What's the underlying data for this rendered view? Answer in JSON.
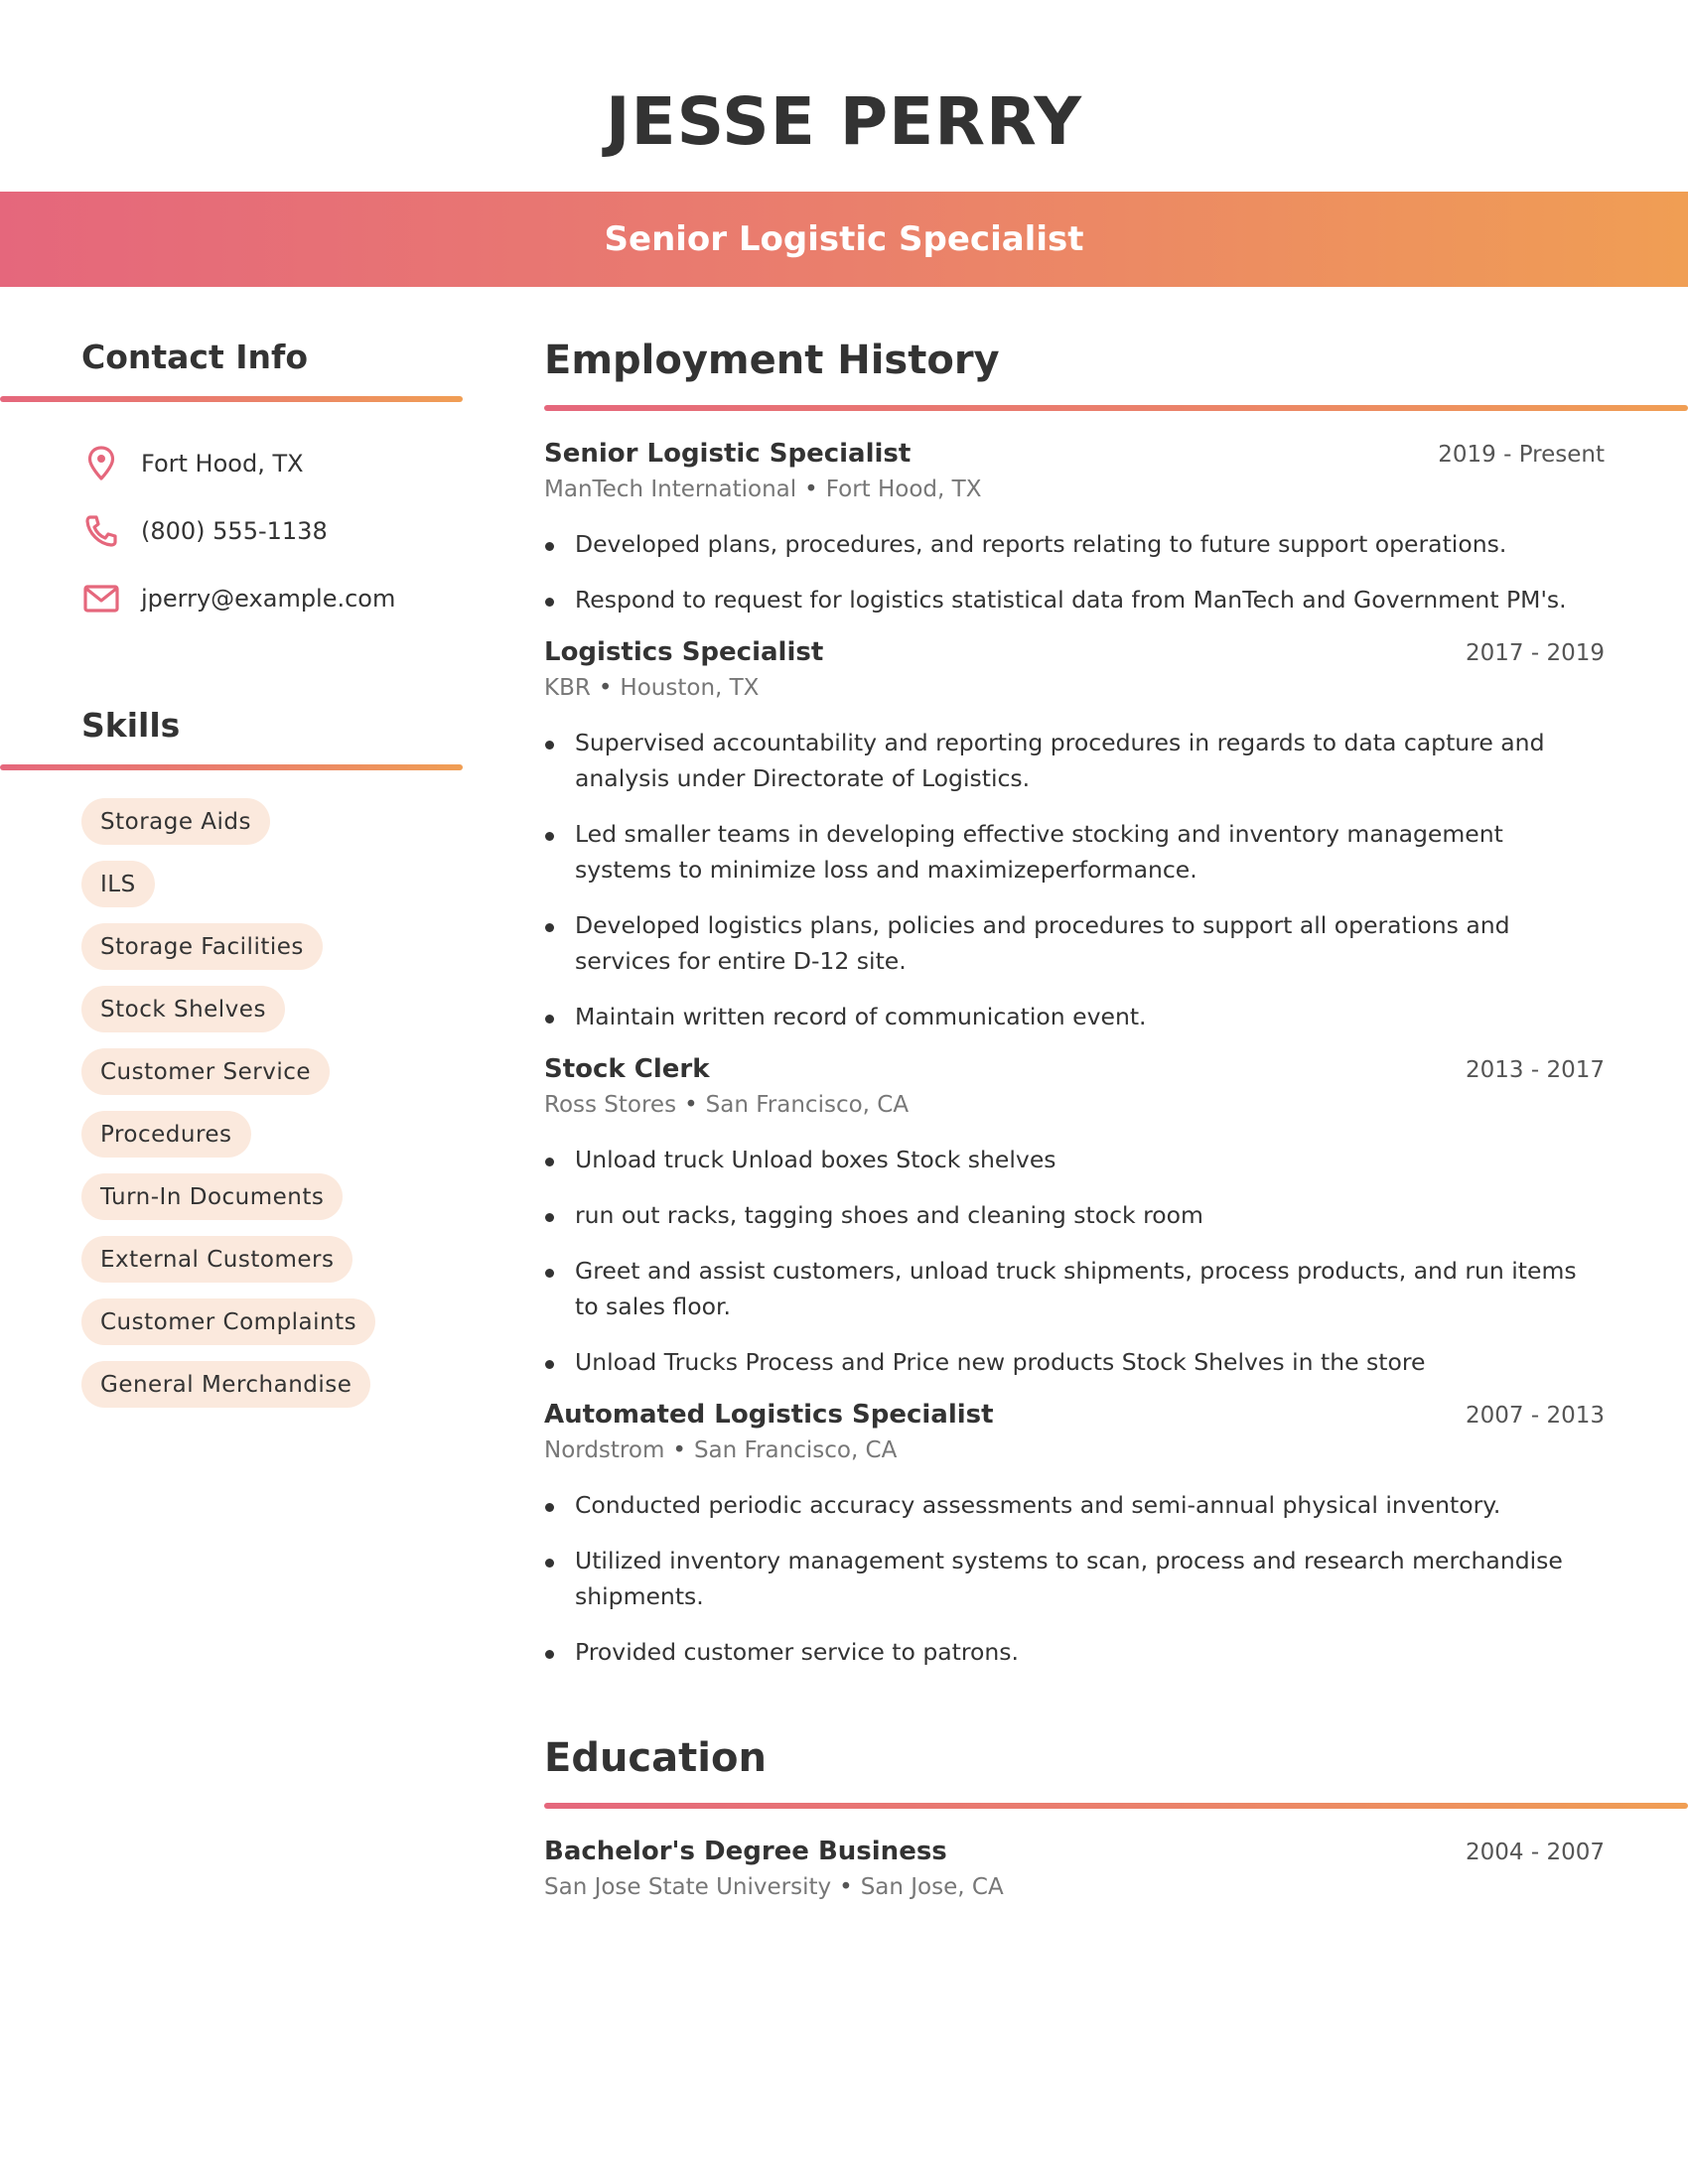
{
  "header": {
    "name": "JESSE PERRY",
    "headline": "Senior Logistic Specialist"
  },
  "theme": {
    "gradient_start": "#e5677c",
    "gradient_end": "#f09e54",
    "chip_bg": "#fbe9dd",
    "text": "#333333"
  },
  "contact": {
    "title": "Contact Info",
    "items": [
      {
        "icon": "location-pin-icon",
        "text": "Fort Hood, TX"
      },
      {
        "icon": "phone-icon",
        "text": "(800) 555-1138"
      },
      {
        "icon": "mail-icon",
        "text": "jperry@example.com"
      }
    ]
  },
  "skills": {
    "title": "Skills",
    "items": [
      "Storage Aids",
      "ILS",
      "Storage Facilities",
      "Stock Shelves",
      "Customer Service",
      "Procedures",
      "Turn-In Documents",
      "External Customers",
      "Customer Complaints",
      "General Merchandise"
    ]
  },
  "employment": {
    "title": "Employment History",
    "jobs": [
      {
        "title": "Senior Logistic Specialist",
        "dates": "2019 - Present",
        "company": "ManTech International",
        "location": "Fort Hood, TX",
        "bullets": [
          "Developed plans, procedures, and reports relating to future support operations.",
          "Respond to request for logistics statistical data from ManTech and Government PM's."
        ]
      },
      {
        "title": "Logistics Specialist",
        "dates": "2017 - 2019",
        "company": "KBR",
        "location": "Houston, TX",
        "bullets": [
          "Supervised accountability and reporting procedures in regards to data capture and analysis under Directorate of Logistics.",
          "Led smaller teams in developing effective stocking and inventory management systems to minimize loss and maximizeperformance.",
          "Developed logistics plans, policies and procedures to support all operations and services for entire D-12 site.",
          "Maintain written record of communication event."
        ]
      },
      {
        "title": "Stock Clerk",
        "dates": "2013 - 2017",
        "company": "Ross Stores",
        "location": "San Francisco, CA",
        "bullets": [
          "Unload truck Unload boxes Stock shelves",
          "run out racks, tagging shoes and cleaning stock room",
          "Greet and assist customers, unload truck shipments, process products, and run items to sales floor.",
          "Unload Trucks Process and Price new products Stock Shelves in the store"
        ]
      },
      {
        "title": "Automated Logistics Specialist",
        "dates": "2007 - 2013",
        "company": "Nordstrom",
        "location": "San Francisco, CA",
        "bullets": [
          "Conducted periodic accuracy assessments and semi-annual physical inventory.",
          "Utilized inventory management systems to scan, process and research merchandise shipments.",
          "Provided customer service to patrons."
        ]
      }
    ]
  },
  "education": {
    "title": "Education",
    "entries": [
      {
        "degree": "Bachelor's Degree Business",
        "dates": "2004 - 2007",
        "school": "San Jose State University",
        "location": "San Jose, CA"
      }
    ]
  }
}
